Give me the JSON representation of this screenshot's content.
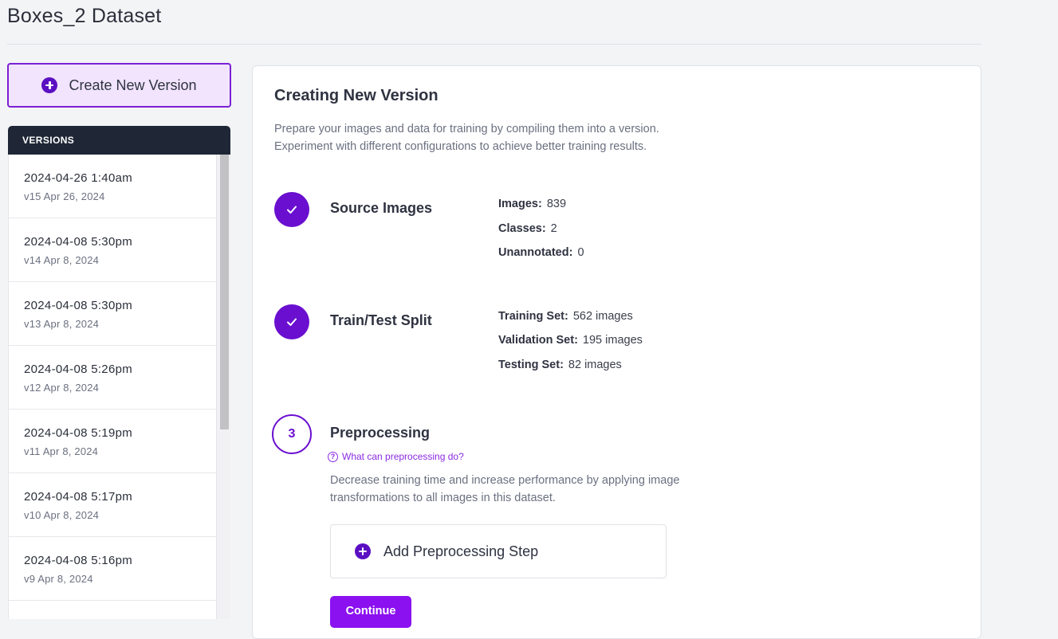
{
  "page": {
    "title": "Boxes_2 Dataset"
  },
  "create_button": {
    "label": "Create New Version"
  },
  "versions": {
    "header": "VERSIONS",
    "items": [
      {
        "name": "2024-04-26 1:40am",
        "meta": "v15 Apr 26, 2024"
      },
      {
        "name": "2024-04-08 5:30pm",
        "meta": "v14 Apr 8, 2024"
      },
      {
        "name": "2024-04-08 5:30pm",
        "meta": "v13 Apr 8, 2024"
      },
      {
        "name": "2024-04-08 5:26pm",
        "meta": "v12 Apr 8, 2024"
      },
      {
        "name": "2024-04-08 5:19pm",
        "meta": "v11 Apr 8, 2024"
      },
      {
        "name": "2024-04-08 5:17pm",
        "meta": "v10 Apr 8, 2024"
      },
      {
        "name": "2024-04-08 5:16pm",
        "meta": "v9 Apr 8, 2024"
      },
      {
        "name": "",
        "meta": ""
      }
    ]
  },
  "main": {
    "title": "Creating New Version",
    "description_line1": "Prepare your images and data for training by compiling them into a version.",
    "description_line2": "Experiment with different configurations to achieve better training results.",
    "steps": {
      "source_images": {
        "title": "Source Images",
        "stats": [
          {
            "label": "Images:",
            "value": "839"
          },
          {
            "label": "Classes:",
            "value": "2"
          },
          {
            "label": "Unannotated:",
            "value": "0"
          }
        ]
      },
      "train_test_split": {
        "title": "Train/Test Split",
        "stats": [
          {
            "label": "Training Set:",
            "value": "562 images"
          },
          {
            "label": "Validation Set:",
            "value": "195 images"
          },
          {
            "label": "Testing Set:",
            "value": "82 images"
          }
        ]
      },
      "preprocessing": {
        "number": "3",
        "title": "Preprocessing",
        "help_link": "What can preprocessing do?",
        "help_icon_glyph": "?",
        "description_line1": "Decrease training time and increase performance by applying image",
        "description_line2": "transformations to all images in this dataset.",
        "add_button": "Add Preprocessing Step",
        "continue_button": "Continue"
      }
    }
  },
  "icons": {
    "create": "plus-circle-icon",
    "step_done": "checkmark-icon",
    "help": "question-circle-icon",
    "add_step": "plus-circle-icon"
  },
  "colors": {
    "accent": "#6a0fcf",
    "accent_bright": "#8b11f0",
    "create_button_bg": "#f1e4fc",
    "versions_header_bg": "#1f2736",
    "link": "#8a2be2"
  }
}
